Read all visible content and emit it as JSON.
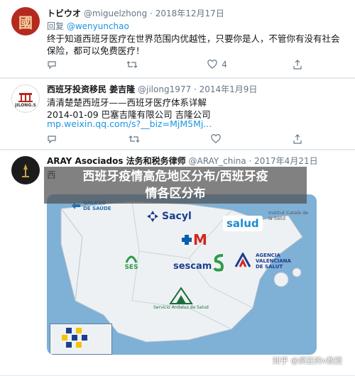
{
  "tweets": [
    {
      "name": "トビウオ",
      "handle": "@miguelzhong",
      "date": "· 2018年12月17日",
      "reply_to": "回复",
      "reply_handle": "@wenyunchao",
      "text_line1": "终于知道西班牙医疗在世界范围内优越性，只要你是人，不管你有没有社会",
      "text_line2": "保险，都可以免费医疗！",
      "reply_count": "",
      "retweet_count": "",
      "like_count": "4",
      "avatar_glyph": "國"
    },
    {
      "name": "西班牙投资移民 姜吉隆",
      "handle": "@jilong1977",
      "date": "· 2014年1月9日",
      "text_line1": "清清楚楚西班牙——西班牙医疗体系详解",
      "text_line2": "2014-01-09 巴塞吉隆有限公司 吉隆公司",
      "link": "mp.weixin.qq.com/s?__biz=MjM5Mj...",
      "reply_count": "",
      "retweet_count": "",
      "like_count": "",
      "avatar_text": "JILONG.S"
    },
    {
      "name": "ARAY Asociados 法务和税务律师",
      "handle": "@ARAY_china",
      "date": "· 2017年4月21日",
      "text_line1": "西"
    }
  ],
  "overlay": {
    "line1": "西班牙疫情高危地区分布/西班牙疫",
    "line2": "情各区分布"
  },
  "map_logos": {
    "galego": "GALEGO DE SAÚDE",
    "sacyl": "Sacyl",
    "salud": "salud",
    "catala": "Institut Català de la Salut",
    "ses": "SES",
    "sescam": "sescam",
    "sas": "Servicio Andaluz de Salud",
    "valenciana": "AGENCIA VALENCIANA DE SALUT",
    "madrid": "M"
  },
  "watermark": "知乎 @疯狂的v教授",
  "colors": {
    "link": "#1b95e0",
    "map_sea": "#7fb0d6",
    "map_land": "#eef1f4"
  }
}
